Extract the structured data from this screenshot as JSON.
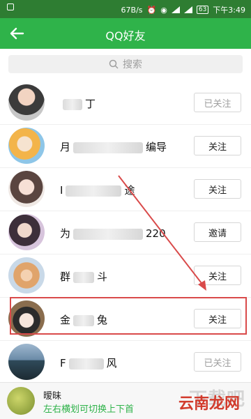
{
  "status": {
    "speed": "67B/s",
    "battery": "63",
    "time": "下午3:49"
  },
  "appbar": {
    "title": "QQ好友"
  },
  "search": {
    "placeholder": "搜索"
  },
  "contacts": [
    {
      "name_prefix": "",
      "name_suffix": "丁",
      "button": "已关注",
      "button_state": "followed"
    },
    {
      "name_prefix": "月",
      "name_suffix": "编导",
      "button": "关注",
      "button_state": "follow"
    },
    {
      "name_prefix": "I",
      "name_suffix": "途",
      "button": "关注",
      "button_state": "follow"
    },
    {
      "name_prefix": "为",
      "name_suffix": "220",
      "button": "邀请",
      "button_state": "invite"
    },
    {
      "name_prefix": "群",
      "name_suffix": "斗",
      "button": "关注",
      "button_state": "follow"
    },
    {
      "name_prefix": "金",
      "name_suffix": "兔",
      "button": "关注",
      "button_state": "follow"
    },
    {
      "name_prefix": "F",
      "name_suffix": "风",
      "button": "已关注",
      "button_state": "followed"
    }
  ],
  "footer": {
    "title": "暧昧",
    "hint": "左右横划可切换上下首"
  },
  "watermark": {
    "text1": "下载吧",
    "text2": "云南龙网"
  },
  "colors": {
    "statusbar": "#2e7d32",
    "appbar": "#2fb34a",
    "highlight": "#d94a4a"
  }
}
